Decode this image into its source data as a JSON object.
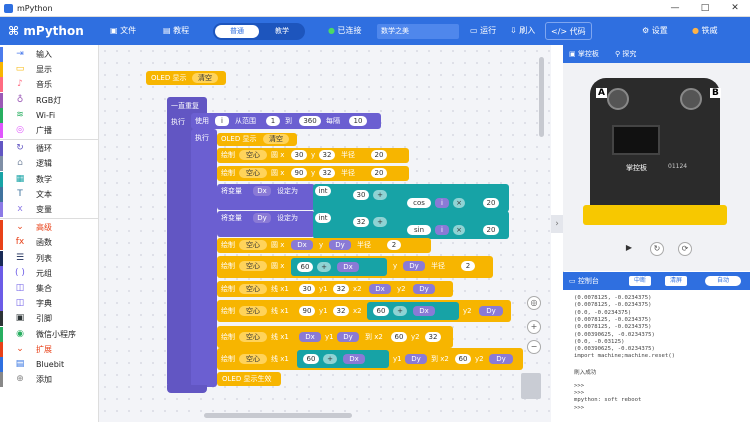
{
  "window": {
    "title": "mPython",
    "min": "—",
    "max": "□",
    "close": "✕"
  },
  "topbar": {
    "logo": "mPython",
    "file": "文件",
    "tutorial": "教程",
    "mode_normal": "普通",
    "mode_teach": "教学",
    "status": "已连接",
    "device": "数学之美",
    "run": "运行",
    "flash": "刷入",
    "code": "代码",
    "settings": "设置",
    "user": "铁威"
  },
  "sidebar": {
    "items": [
      {
        "label": "输入",
        "color": "#4b7bec",
        "icon": "⇥"
      },
      {
        "label": "显示",
        "color": "#f7b500",
        "icon": "▭"
      },
      {
        "label": "音乐",
        "color": "#ff6b81",
        "icon": "♪"
      },
      {
        "label": "RGB灯",
        "color": "#9b59b6",
        "icon": "♁"
      },
      {
        "label": "Wi-Fi",
        "color": "#27ae60",
        "icon": "≋"
      },
      {
        "label": "广播",
        "color": "#e056fd",
        "icon": "◎"
      },
      {
        "label": "循环",
        "color": "#6256c3",
        "icon": "↻"
      },
      {
        "label": "逻辑",
        "color": "#7f8fa6",
        "icon": "⌂"
      },
      {
        "label": "数学",
        "color": "#17a3a6",
        "icon": "▦"
      },
      {
        "label": "文本",
        "color": "#40739e",
        "icon": "T"
      },
      {
        "label": "变量",
        "color": "#8c7ae6",
        "icon": "x"
      },
      {
        "label": "高级",
        "color": "#e84118",
        "icon": "⌄"
      },
      {
        "label": "函数",
        "color": "#e84118",
        "icon": "fx"
      },
      {
        "label": "列表",
        "color": "#192a56",
        "icon": "☰"
      },
      {
        "label": "元组",
        "color": "#6c5ce7",
        "icon": "( )"
      },
      {
        "label": "集合",
        "color": "#6c5ce7",
        "icon": "◫"
      },
      {
        "label": "字典",
        "color": "#6c5ce7",
        "icon": "◫"
      },
      {
        "label": "引脚",
        "color": "#2d3436",
        "icon": "▣"
      },
      {
        "label": "微信小程序",
        "color": "#27ae60",
        "icon": "◉"
      },
      {
        "label": "扩展",
        "color": "#e84118",
        "icon": "⌄"
      },
      {
        "label": "Bluebit",
        "color": "#2f6fe0",
        "icon": "▤"
      },
      {
        "label": "添加",
        "color": "#888",
        "icon": "⊕"
      }
    ]
  },
  "blocks": {
    "oled_clear": "OLED 显示",
    "clear": "清空",
    "forever": "一直重复",
    "exec": "执行",
    "use": "使用",
    "var_i": "i",
    "range_from": "从范围",
    "v1": "1",
    "to": "到",
    "v360": "360",
    "step": "每隔",
    "v10": "10",
    "exec2": "执行",
    "draw": "绘制",
    "hollow": "空心",
    "circle": "圆 x",
    "cy": "y",
    "radius": "半径",
    "v32": "32",
    "v90": "90",
    "v20": "20",
    "set_var": "将变量",
    "dx": "Dx",
    "dy": "Dy",
    "set_to": "设定为",
    "int": "int",
    "v30": "30",
    "plus": "+",
    "times": "×",
    "cos": "cos",
    "sin": "sin",
    "v2": "2",
    "v60": "60",
    "line": "线 x1",
    "y1": "y1",
    "x2": "x2",
    "y2": "y2",
    "to2": "到 x2",
    "oled_show": "OLED 显示生效"
  },
  "rightpanel": {
    "tab_ctrl": "掌控板",
    "tab_explore": "探究",
    "btn_a": "A",
    "btn_b": "B",
    "brand": "掌控板",
    "serial": "01124",
    "console_title": "控制台",
    "c_btn1": "中断",
    "c_btn2": "清屏",
    "c_btn3": "自动"
  },
  "console_lines": [
    "(0.0078125, -0.0234375)",
    "(0.0078125, -0.0234375)",
    "(0.0, -0.0234375)",
    "(0.0078125, -0.0234375)",
    "(0.0078125, -0.0234375)",
    "(0.00390625, -0.0234375)",
    "(0.0, -0.03125)",
    "(0.00390625, -0.0234375)",
    "import machine;machine.reset()",
    "",
    "刷入成功",
    "",
    ">>>",
    ">>>",
    "mpython: soft reboot",
    ">>>"
  ]
}
